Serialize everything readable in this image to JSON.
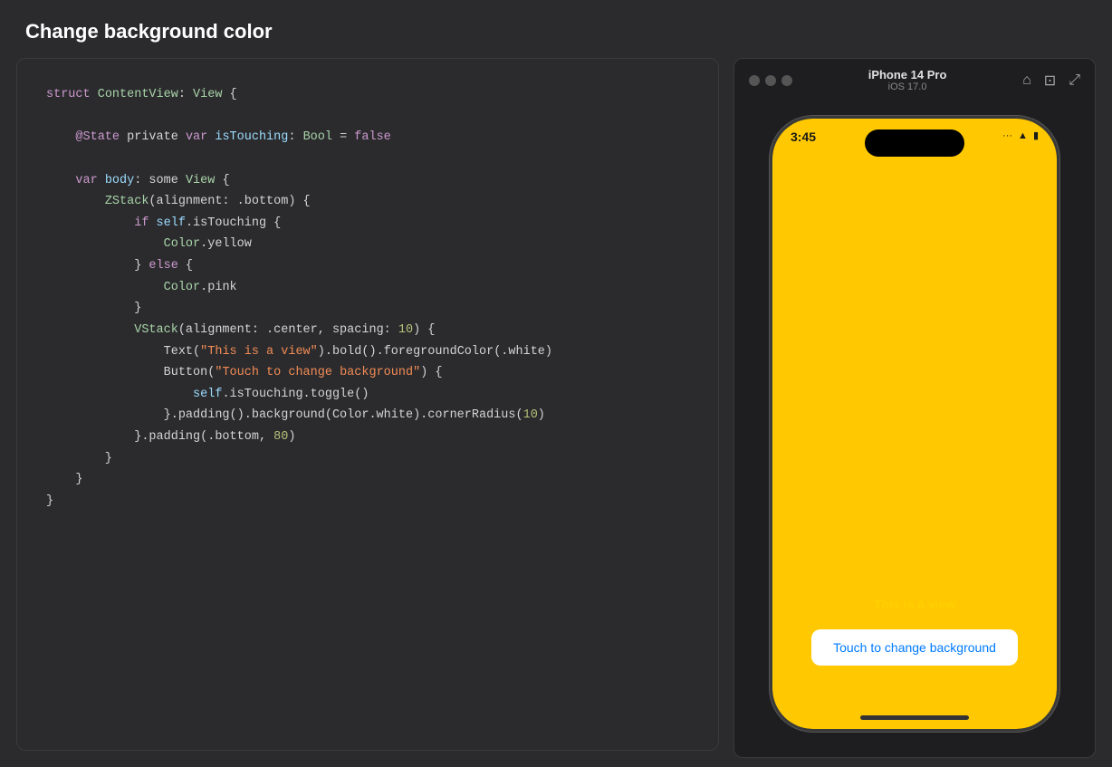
{
  "page": {
    "title": "Change background color"
  },
  "code": {
    "lines": [
      {
        "tokens": [
          {
            "text": "struct ",
            "cls": "kw"
          },
          {
            "text": "ContentView",
            "cls": "type"
          },
          {
            "text": ": ",
            "cls": "plain"
          },
          {
            "text": "View",
            "cls": "type"
          },
          {
            "text": " {",
            "cls": "plain"
          }
        ]
      },
      {
        "tokens": []
      },
      {
        "tokens": [
          {
            "text": "    @State",
            "cls": "attr"
          },
          {
            "text": " private ",
            "cls": "plain"
          },
          {
            "text": "var ",
            "cls": "kw"
          },
          {
            "text": "isTouching",
            "cls": "prop"
          },
          {
            "text": ": ",
            "cls": "plain"
          },
          {
            "text": "Bool",
            "cls": "type"
          },
          {
            "text": " = ",
            "cls": "plain"
          },
          {
            "text": "false",
            "cls": "kw"
          }
        ]
      },
      {
        "tokens": []
      },
      {
        "tokens": [
          {
            "text": "    ",
            "cls": "plain"
          },
          {
            "text": "var ",
            "cls": "kw"
          },
          {
            "text": "body",
            "cls": "prop"
          },
          {
            "text": ": some ",
            "cls": "plain"
          },
          {
            "text": "View",
            "cls": "type"
          },
          {
            "text": " {",
            "cls": "plain"
          }
        ]
      },
      {
        "tokens": [
          {
            "text": "        ",
            "cls": "plain"
          },
          {
            "text": "ZStack",
            "cls": "type"
          },
          {
            "text": "(alignment: .bottom) {",
            "cls": "plain"
          }
        ]
      },
      {
        "tokens": [
          {
            "text": "            ",
            "cls": "plain"
          },
          {
            "text": "if ",
            "cls": "kw"
          },
          {
            "text": "self",
            "cls": "prop"
          },
          {
            "text": ".isTouching {",
            "cls": "plain"
          }
        ]
      },
      {
        "tokens": [
          {
            "text": "                ",
            "cls": "plain"
          },
          {
            "text": "Color",
            "cls": "type"
          },
          {
            "text": ".yellow",
            "cls": "plain"
          }
        ]
      },
      {
        "tokens": [
          {
            "text": "            } ",
            "cls": "plain"
          },
          {
            "text": "else",
            "cls": "kw"
          },
          {
            "text": " {",
            "cls": "plain"
          }
        ]
      },
      {
        "tokens": [
          {
            "text": "                ",
            "cls": "plain"
          },
          {
            "text": "Color",
            "cls": "type"
          },
          {
            "text": ".pink",
            "cls": "plain"
          }
        ]
      },
      {
        "tokens": [
          {
            "text": "            }",
            "cls": "plain"
          }
        ]
      },
      {
        "tokens": [
          {
            "text": "            ",
            "cls": "plain"
          },
          {
            "text": "VStack",
            "cls": "type"
          },
          {
            "text": "(alignment: .center, spacing: ",
            "cls": "plain"
          },
          {
            "text": "10",
            "cls": "num"
          },
          {
            "text": ") {",
            "cls": "plain"
          }
        ]
      },
      {
        "tokens": [
          {
            "text": "                ",
            "cls": "plain"
          },
          {
            "text": "Text(",
            "cls": "plain"
          },
          {
            "text": "\"This is a view\"",
            "cls": "str"
          },
          {
            "text": ").bold().foregroundColor(.white)",
            "cls": "plain"
          }
        ]
      },
      {
        "tokens": [
          {
            "text": "                ",
            "cls": "plain"
          },
          {
            "text": "Button(",
            "cls": "plain"
          },
          {
            "text": "\"Touch to change background\"",
            "cls": "str"
          },
          {
            "text": ") {",
            "cls": "plain"
          }
        ]
      },
      {
        "tokens": [
          {
            "text": "                    ",
            "cls": "plain"
          },
          {
            "text": "self",
            "cls": "prop"
          },
          {
            "text": ".isTouching.toggle()",
            "cls": "plain"
          }
        ]
      },
      {
        "tokens": [
          {
            "text": "                }.padding().background(Color.white).cornerRadius(",
            "cls": "plain"
          },
          {
            "text": "10",
            "cls": "num"
          },
          {
            "text": ")",
            "cls": "plain"
          }
        ]
      },
      {
        "tokens": [
          {
            "text": "            }.padding(.bottom, ",
            "cls": "plain"
          },
          {
            "text": "80",
            "cls": "num"
          },
          {
            "text": ")",
            "cls": "plain"
          }
        ]
      },
      {
        "tokens": [
          {
            "text": "        }",
            "cls": "plain"
          }
        ]
      },
      {
        "tokens": [
          {
            "text": "    }",
            "cls": "plain"
          }
        ]
      },
      {
        "tokens": [
          {
            "text": "}",
            "cls": "plain"
          }
        ]
      }
    ]
  },
  "simulator": {
    "device_name": "iPhone 14 Pro",
    "os_version": "iOS 17.0",
    "time": "3:45",
    "toolbar_icons": [
      "home",
      "screenshot",
      "rotate"
    ],
    "phone_bg_color": "#ffc800",
    "view_label": "This is a view",
    "button_label": "Touch to change background"
  }
}
